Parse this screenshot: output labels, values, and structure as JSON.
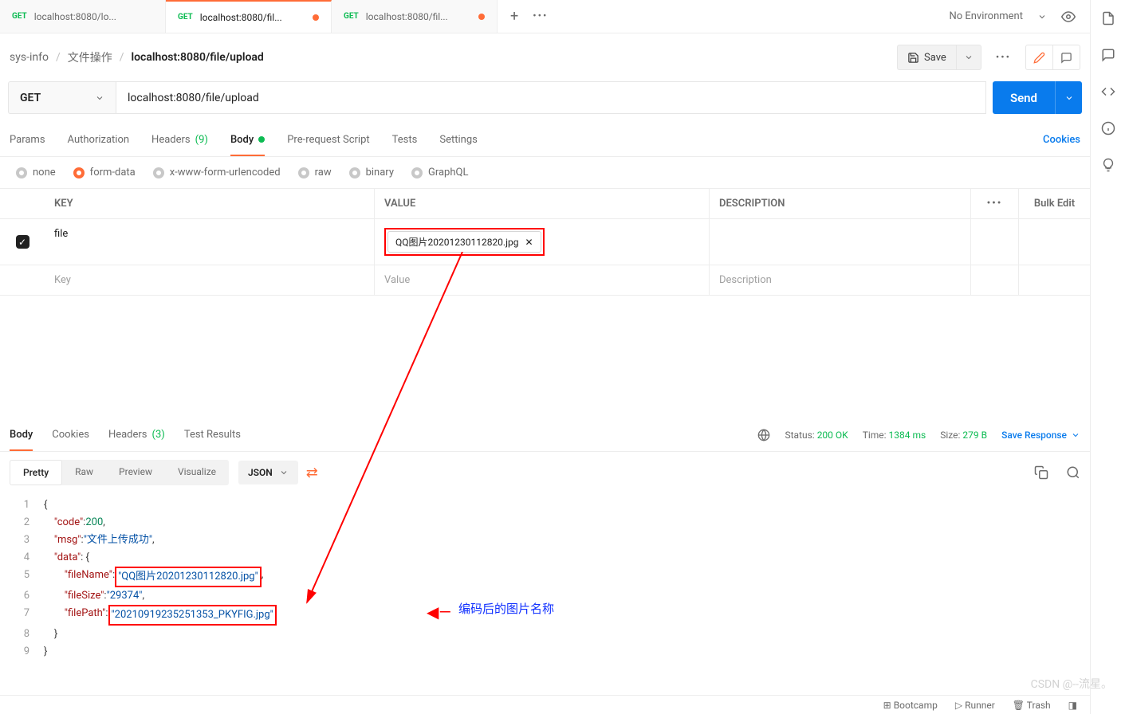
{
  "tabs": [
    {
      "method": "GET",
      "title": "localhost:8080/lo...",
      "dirty": false,
      "active": false
    },
    {
      "method": "GET",
      "title": "localhost:8080/fil...",
      "dirty": true,
      "active": true
    },
    {
      "method": "GET",
      "title": "localhost:8080/fil...",
      "dirty": true,
      "active": false
    }
  ],
  "env": {
    "label": "No Environment"
  },
  "breadcrumb": {
    "a": "sys-info",
    "b": "文件操作",
    "c": "localhost:8080/file/upload"
  },
  "toolbar": {
    "save": "Save"
  },
  "request": {
    "method": "GET",
    "url": "localhost:8080/file/upload",
    "send": "Send"
  },
  "reqtabs": {
    "params": "Params",
    "auth": "Authorization",
    "headers": "Headers",
    "headers_n": "(9)",
    "body": "Body",
    "pre": "Pre-request Script",
    "tests": "Tests",
    "settings": "Settings",
    "cookies": "Cookies"
  },
  "body_types": {
    "none": "none",
    "form": "form-data",
    "url": "x-www-form-urlencoded",
    "raw": "raw",
    "binary": "binary",
    "gql": "GraphQL"
  },
  "ptable": {
    "head": {
      "key": "KEY",
      "value": "VALUE",
      "desc": "DESCRIPTION",
      "more": "•••",
      "bulk": "Bulk Edit"
    },
    "rows": [
      {
        "enabled": true,
        "key": "file",
        "value": "QQ图片20201230112820.jpg",
        "desc": ""
      }
    ],
    "placeholder": {
      "key": "Key",
      "value": "Value",
      "desc": "Description"
    }
  },
  "resp": {
    "tabs": {
      "body": "Body",
      "cookies": "Cookies",
      "headers": "Headers",
      "headers_n": "(3)",
      "test": "Test Results"
    },
    "status_lbl": "Status:",
    "status": "200 OK",
    "time_lbl": "Time:",
    "time": "1384 ms",
    "size_lbl": "Size:",
    "size": "279 B",
    "saveresp": "Save Response"
  },
  "viewseg": {
    "pretty": "Pretty",
    "raw": "Raw",
    "preview": "Preview",
    "visualize": "Visualize",
    "lang": "JSON"
  },
  "json": {
    "code": 200,
    "msg": "文件上传成功",
    "fileName": "QQ图片20201230112820.jpg",
    "fileSize": "29374",
    "filePath": "20210919235251353_PKYFIG.jpg"
  },
  "annotation": "编码后的图片名称",
  "footer": {
    "bootcamp": "Bootcamp",
    "runner": "Runner",
    "trash": "Trash"
  },
  "watermark": "CSDN @--流星。"
}
